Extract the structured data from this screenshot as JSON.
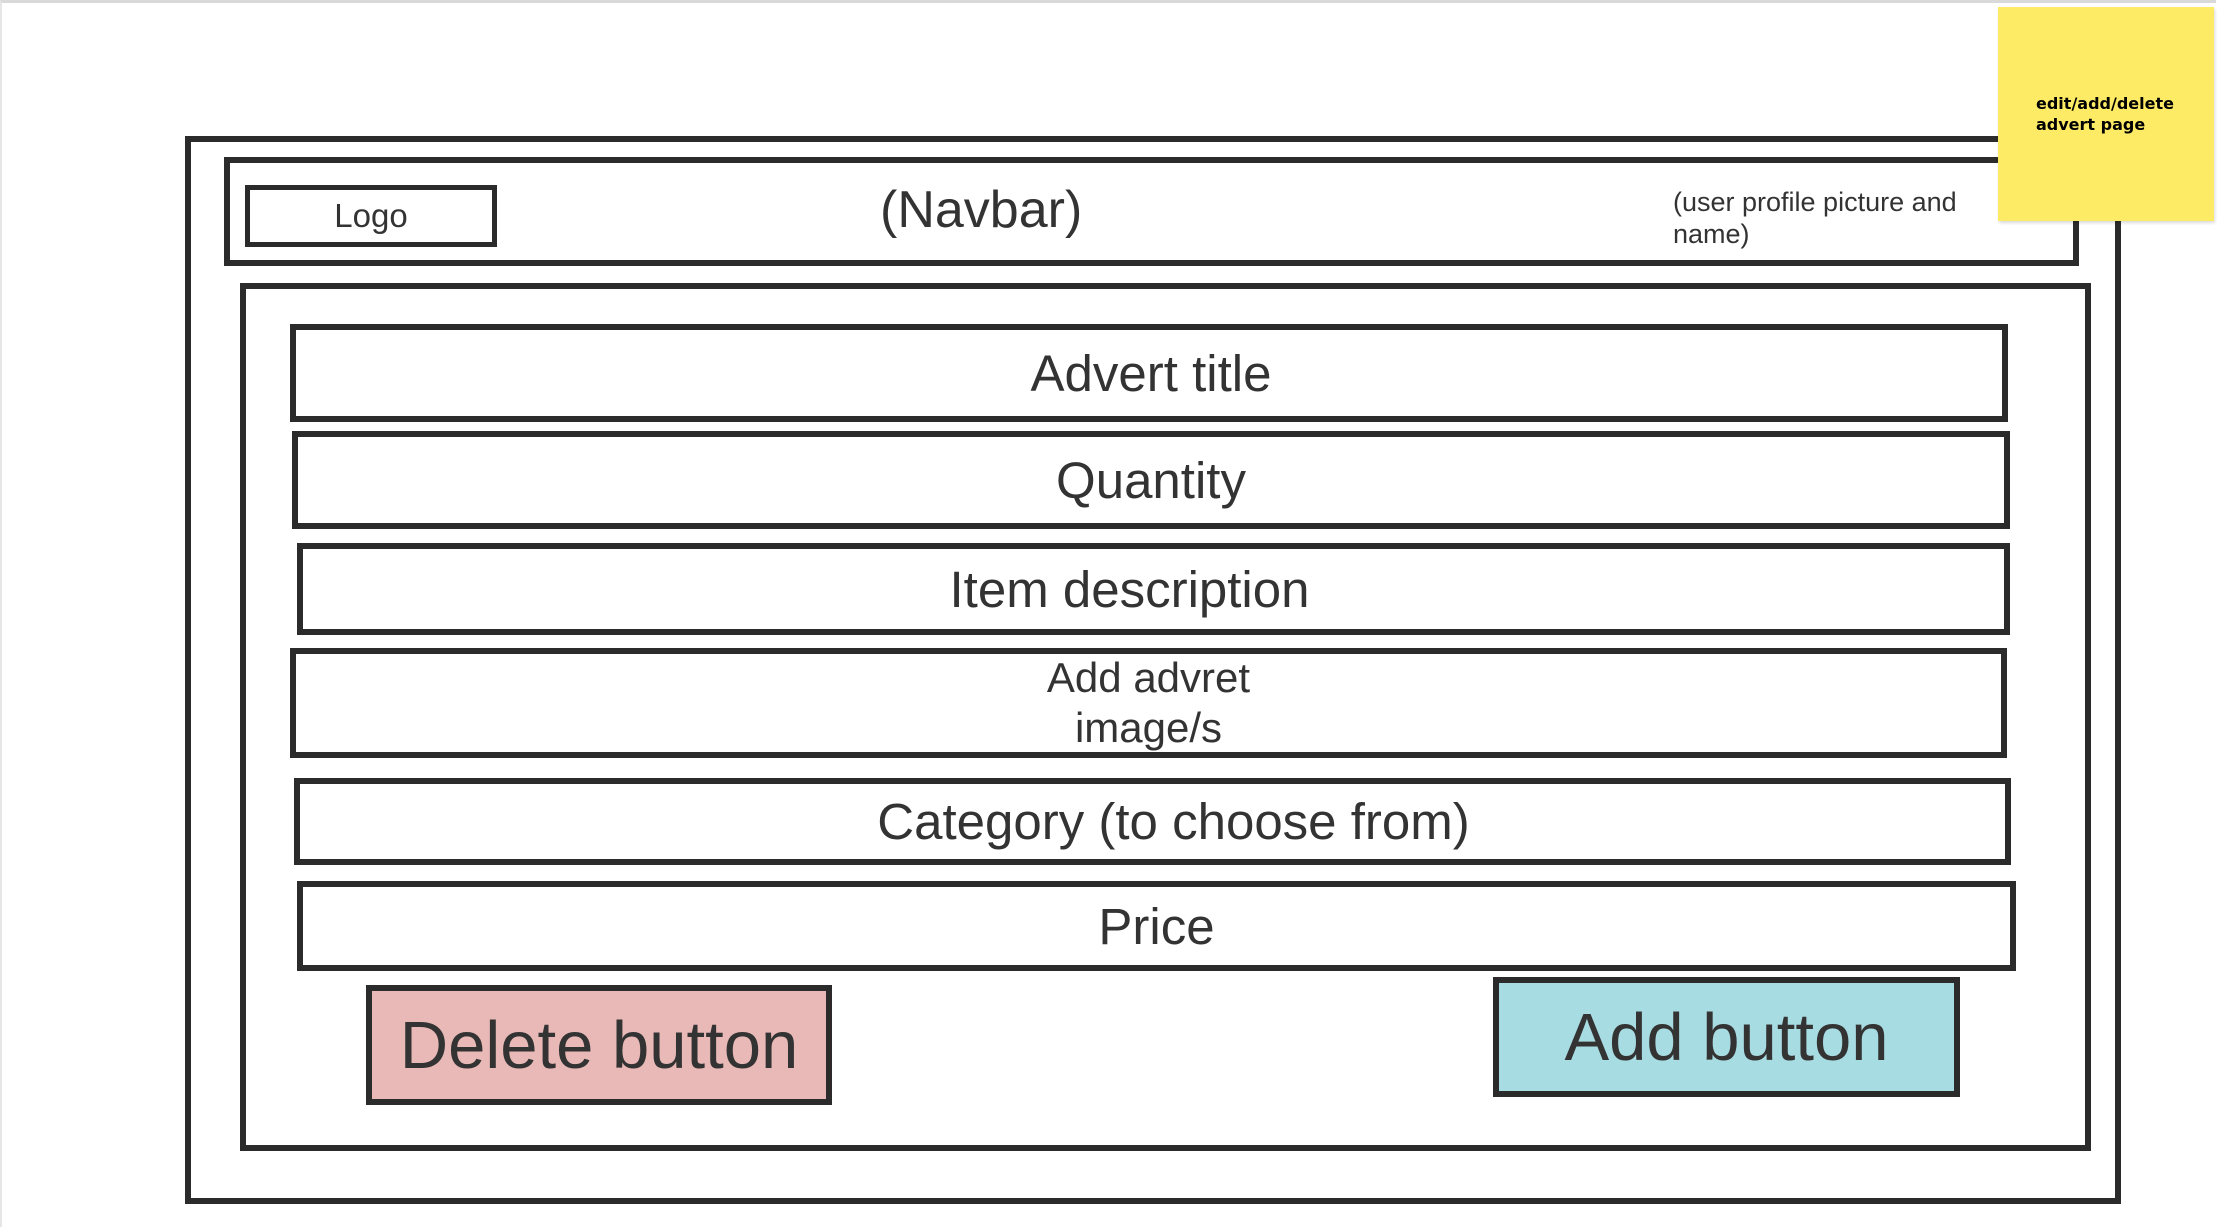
{
  "colors": {
    "delete_button_bg": "#e8b9b6",
    "add_button_bg": "#a8dce3",
    "sticky_note_bg": "#fdeb66",
    "wireframe_stroke": "#2b2b2b"
  },
  "navbar": {
    "logo_label": "Logo",
    "title": "(Navbar)",
    "profile_text": "(user profile picture and name)"
  },
  "form": {
    "fields": [
      {
        "label": "Advert title"
      },
      {
        "label": "Quantity"
      },
      {
        "label": "Item description"
      },
      {
        "label": "Add advret\nimage/s"
      },
      {
        "label": "Category (to choose from)"
      },
      {
        "label": "Price"
      }
    ],
    "delete_button": "Delete button",
    "add_button": "Add button"
  },
  "sticky_note": {
    "text": "edit/add/delete advert page"
  }
}
